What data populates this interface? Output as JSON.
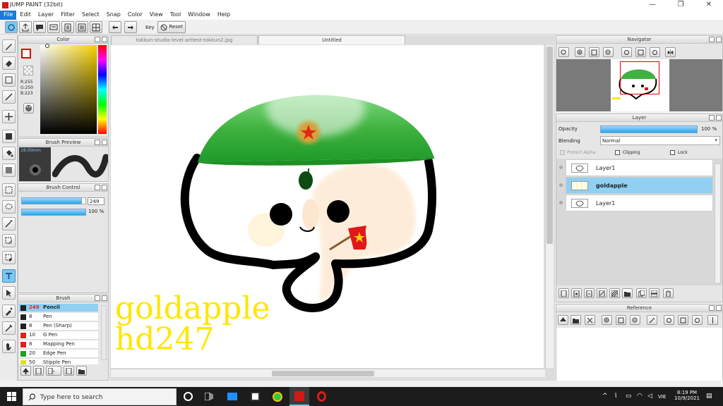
{
  "window": {
    "title": "JUMP PAINT (32bit)",
    "controls": [
      "—",
      "❐",
      "✕"
    ]
  },
  "menu": [
    "File",
    "Edit",
    "Layer",
    "Filter",
    "Select",
    "Snap",
    "Color",
    "View",
    "Tool",
    "Window",
    "Help"
  ],
  "toolbar": {
    "key_label": "Key",
    "reset_label": "Reset"
  },
  "tabs": [
    "tokkun-studio-level-arttest-tokkun2.jpg",
    "Untitled"
  ],
  "color_panel": {
    "title": "Color",
    "r": "R:255",
    "g": "G:250",
    "b": "B:223",
    "fg_color": "#ffffff",
    "accent": "#e00000"
  },
  "brush_preview": {
    "title": "Brush Preview",
    "size": "18.00mm"
  },
  "brush_control": {
    "title": "Brush Control",
    "size_value": "249",
    "opacity_value": "100 %",
    "size_fraction": 0.93,
    "opacity_fraction": 1.0
  },
  "brush_list": {
    "title": "Brush",
    "items": [
      {
        "size": "249",
        "name": "Pencil",
        "color": "#222222",
        "selected": true
      },
      {
        "size": "8",
        "name": "Pen",
        "color": "#222222"
      },
      {
        "size": "8",
        "name": "Pen (Sharp)",
        "color": "#222222"
      },
      {
        "size": "10",
        "name": "G Pen",
        "color": "#e02020"
      },
      {
        "size": "8",
        "name": "Mapping Pen",
        "color": "#e02020"
      },
      {
        "size": "20",
        "name": "Edge Pen",
        "color": "#20a020"
      },
      {
        "size": "50",
        "name": "Stipple Pen",
        "color": "#e0e020"
      }
    ]
  },
  "navigator": {
    "title": "Navigator"
  },
  "layer_panel": {
    "title": "Layer",
    "opacity_label": "Opacity",
    "opacity_value": "100 %",
    "blending_label": "Blending",
    "blending_value": "Normal",
    "protect_alpha": "Protect Alpha",
    "clipping": "Clipping",
    "lock": "Lock",
    "layers": [
      {
        "name": "Layer1"
      },
      {
        "name": "goldapple",
        "selected": true
      },
      {
        "name": "Layer1"
      }
    ]
  },
  "reference": {
    "title": "Reference"
  },
  "canvas": {
    "watermark_line1": "goldapple",
    "watermark_line2": "hd247"
  },
  "taskbar": {
    "search_placeholder": "Type here to search",
    "lang": "VIE",
    "time": "8:19 PM",
    "date": "10/9/2021"
  }
}
